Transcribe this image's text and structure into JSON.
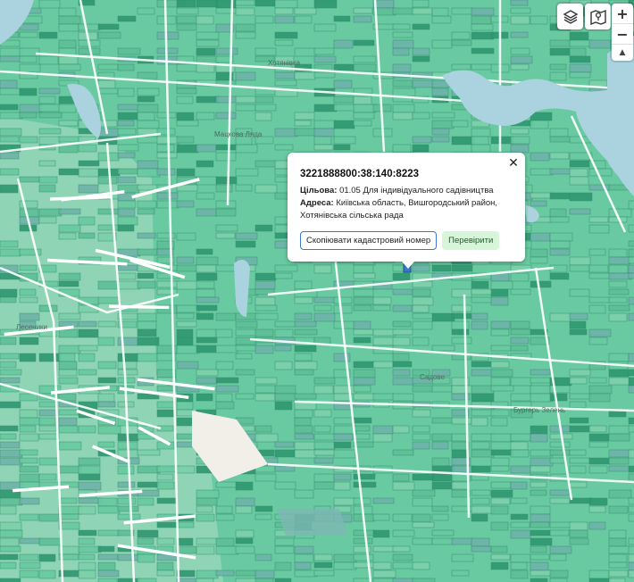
{
  "map": {
    "colors": {
      "background": "#f1efe8",
      "parcel_green": "#69c9a0",
      "parcel_teal": "#6fb3aa",
      "parcel_dark": "#2f9870",
      "parcel_edge": "#2e8a6c",
      "water": "#aad3df",
      "road": "#ffffff",
      "road_major": "#f7fbfa"
    },
    "labels": {
      "settlement": "Хотянівка",
      "district": "Мацкова Ляда",
      "place_right": "Бургерь Зелень",
      "place_center": "Садове",
      "town_left": "Лесеники"
    }
  },
  "controls": {
    "layers_icon": "layers-icon",
    "map_icon": "map-icon",
    "zoom_in": "+",
    "zoom_out": "−",
    "compass": "▲"
  },
  "popup": {
    "cadastral_number": "3221888800:38:140:8223",
    "purpose_label": "Цільова:",
    "purpose_value": "01.05 Для індивідуального садівництва",
    "address_label": "Адреса:",
    "address_value": "Київська область, Вишгородський район,",
    "address_value_2": "Хотянівська сільська рада",
    "copy_button": "Скопіювати кадастровий номер",
    "check_button": "Перевірити",
    "close": "✕"
  }
}
